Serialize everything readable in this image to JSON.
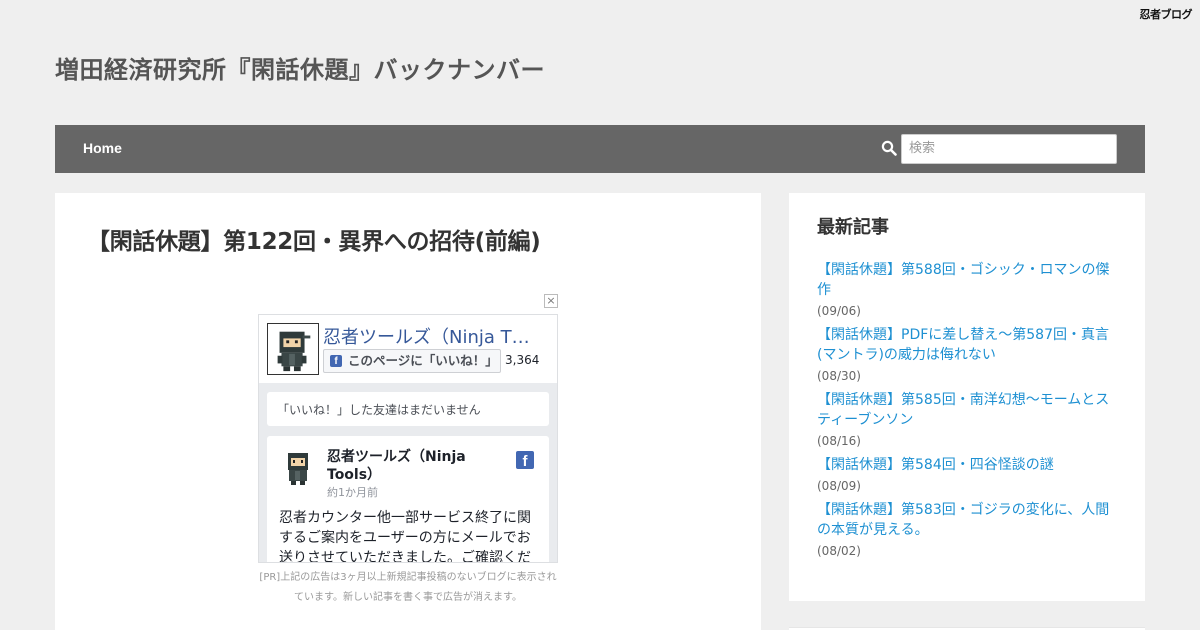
{
  "topbar": {
    "brand": "忍者ブログ"
  },
  "header": {
    "site_title": "増田経済研究所『閑話休題』バックナンバー"
  },
  "nav": {
    "home_label": "Home",
    "search_placeholder": "検索"
  },
  "article": {
    "title": "【閑話休題】第122回・異界への招待(前編)"
  },
  "ad": {
    "close_label": "×",
    "facebook_widget": {
      "page_name": "忍者ツールズ（Ninja T…",
      "like_button_label": "このページに「いいね！」",
      "like_count": "3,364",
      "friends_text": "「いいね！」した友達はまだいません",
      "post_author": "忍者ツールズ（Ninja Tools）",
      "post_time": "約1か月前",
      "post_body": "忍者カウンター他一部サービス終了に関するご案内をユーザーの方にメールでお送りさせていただきました。ご確認ください。"
    },
    "note": "[PR]上記の広告は3ヶ月以上新規記事投稿のないブログに表示されています。新しい記事を書く事で広告が消えます。"
  },
  "sidebar": {
    "widget_title": "最新記事",
    "recent_posts": [
      {
        "title": "【閑話休題】第588回・ゴシック・ロマンの傑作",
        "date": "(09/06)"
      },
      {
        "title": "【閑話休題】PDFに差し替え〜第587回・真言(マントラ)の威力は侮れない",
        "date": "(08/30)"
      },
      {
        "title": "【閑話休題】第585回・南洋幻想〜モームとスティーブンソン",
        "date": "(08/16)"
      },
      {
        "title": "【閑話休題】第584回・四谷怪談の謎",
        "date": "(08/09)"
      },
      {
        "title": "【閑話休題】第583回・ゴジラの変化に、人間の本質が見える。",
        "date": "(08/02)"
      }
    ]
  },
  "colors": {
    "nav_bg": "#666666",
    "link": "#1e90d2",
    "page_bg": "#efefef",
    "facebook_blue": "#4267b2"
  }
}
